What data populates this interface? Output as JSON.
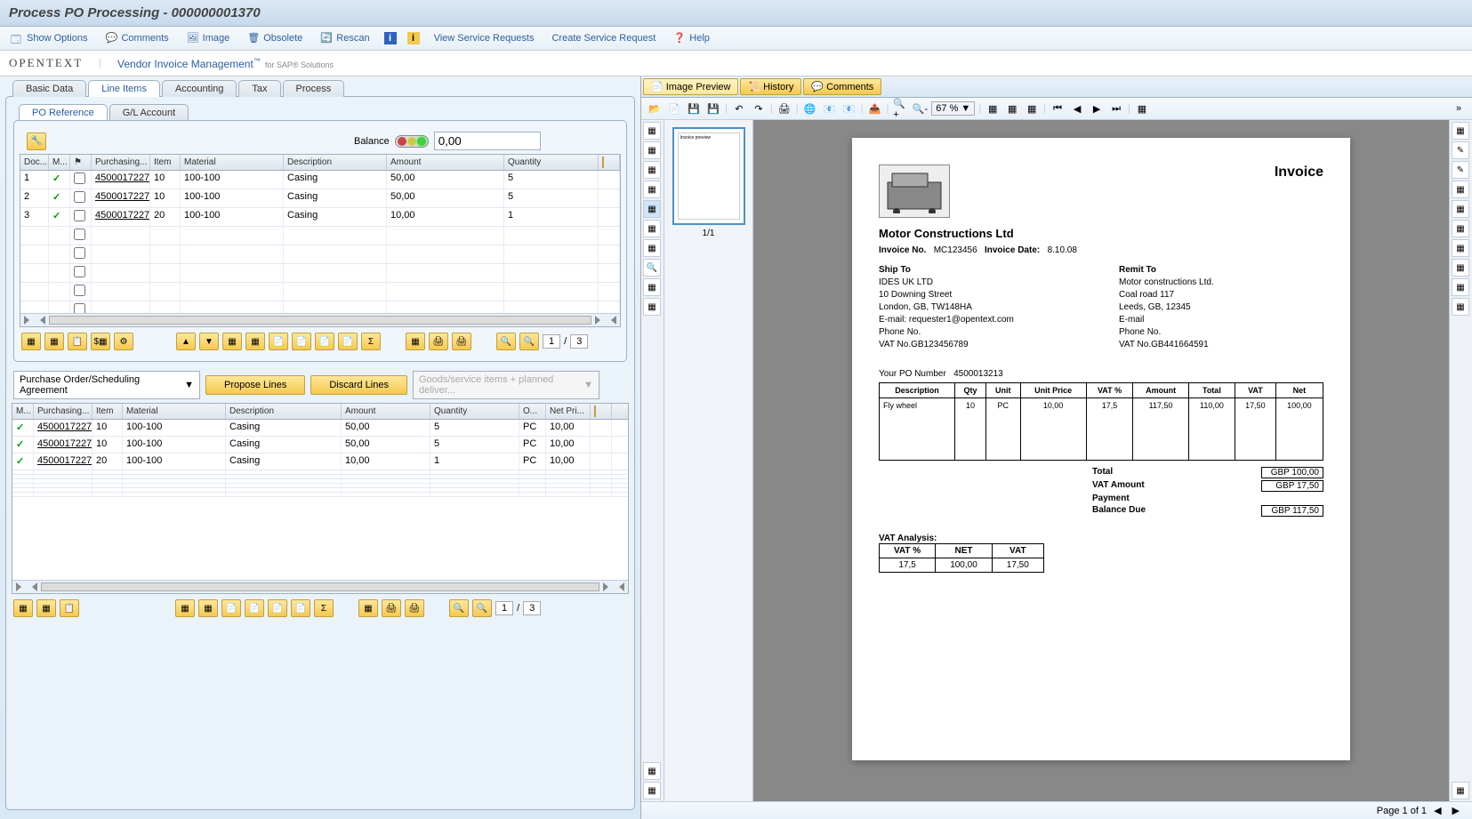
{
  "window": {
    "title": "Process PO Processing - 000000001370"
  },
  "toolbar": {
    "show_options": "Show Options",
    "comments": "Comments",
    "image": "Image",
    "obsolete": "Obsolete",
    "rescan": "Rescan",
    "view_sr": "View Service Requests",
    "create_sr": "Create Service Request",
    "help": "Help"
  },
  "brand": {
    "opentext": "OPENTEXT",
    "product": "Vendor Invoice Management",
    "tm": "™",
    "sub": "for SAP® Solutions"
  },
  "tabs": {
    "basic": "Basic Data",
    "line_items": "Line Items",
    "accounting": "Accounting",
    "tax": "Tax",
    "process": "Process"
  },
  "subtabs": {
    "po_ref": "PO Reference",
    "gl_account": "G/L Account"
  },
  "balance": {
    "label": "Balance",
    "value": "0,00"
  },
  "grid1": {
    "headers": {
      "doc": "Doc...",
      "m": "M...",
      "flag": "",
      "purchasing": "Purchasing...",
      "item": "Item",
      "material": "Material",
      "description": "Description",
      "amount": "Amount",
      "quantity": "Quantity"
    },
    "rows": [
      {
        "doc": "1",
        "chk": true,
        "po": "4500017227",
        "item": "10",
        "material": "100-100",
        "desc": "Casing",
        "amount": "50,00",
        "qty": "5"
      },
      {
        "doc": "2",
        "chk": true,
        "po": "4500017227",
        "item": "10",
        "material": "100-100",
        "desc": "Casing",
        "amount": "50,00",
        "qty": "5"
      },
      {
        "doc": "3",
        "chk": true,
        "po": "4500017227",
        "item": "20",
        "material": "100-100",
        "desc": "Casing",
        "amount": "10,00",
        "qty": "1"
      }
    ],
    "page_current": "1",
    "page_sep": "/",
    "page_total": "3"
  },
  "actions": {
    "po_schedule": "Purchase Order/Scheduling Agreement",
    "propose": "Propose Lines",
    "discard": "Discard Lines",
    "goods": "Goods/service items + planned deliver..."
  },
  "grid2": {
    "headers": {
      "m": "M...",
      "purchasing": "Purchasing...",
      "item": "Item",
      "material": "Material",
      "description": "Description",
      "amount": "Amount",
      "quantity": "Quantity",
      "o": "O...",
      "netpr": "Net Pri..."
    },
    "rows": [
      {
        "chk": true,
        "po": "4500017227",
        "item": "10",
        "material": "100-100",
        "desc": "Casing",
        "amount": "50,00",
        "qty": "5",
        "o": "PC",
        "netpr": "10,00"
      },
      {
        "chk": true,
        "po": "4500017227",
        "item": "10",
        "material": "100-100",
        "desc": "Casing",
        "amount": "50,00",
        "qty": "5",
        "o": "PC",
        "netpr": "10,00"
      },
      {
        "chk": true,
        "po": "4500017227",
        "item": "20",
        "material": "100-100",
        "desc": "Casing",
        "amount": "10,00",
        "qty": "1",
        "o": "PC",
        "netpr": "10,00"
      }
    ],
    "page_current": "1",
    "page_sep": "/",
    "page_total": "3"
  },
  "right_tabs": {
    "preview": "Image Preview",
    "history": "History",
    "comments": "Comments"
  },
  "zoom": "67 %",
  "thumb_label": "1/1",
  "invoice": {
    "title": "Invoice",
    "company": "Motor Constructions Ltd",
    "inv_no_label": "Invoice No.",
    "inv_no": "MC123456",
    "inv_date_label": "Invoice Date:",
    "inv_date": "8.10.08",
    "ship_label": "Ship To",
    "ship": {
      "name": "IDES UK LTD",
      "addr1": "10 Downing Street",
      "addr2": "London, GB, TW148HA",
      "email": "E-mail: requester1@opentext.com",
      "phone": "Phone No.",
      "vat": "VAT No.GB123456789"
    },
    "remit_label": "Remit To",
    "remit": {
      "name": "Motor constructions Ltd.",
      "addr1": "Coal road  117",
      "addr2": "Leeds, GB, 12345",
      "email": "E-mail",
      "phone": "Phone No.",
      "vat": "VAT No.GB441664591"
    },
    "po_label": "Your PO Number",
    "po_no": "4500013213",
    "table": {
      "headers": {
        "desc": "Description",
        "qty": "Qty",
        "unit": "Unit",
        "uprice": "Unit Price",
        "vatp": "VAT %",
        "amount": "Amount",
        "total": "Total",
        "vat": "VAT",
        "net": "Net"
      },
      "rows": [
        {
          "desc": "Fly wheel",
          "qty": "10",
          "unit": "PC",
          "uprice": "10,00",
          "vatp": "17,5",
          "amount": "117,50",
          "total": "110,00",
          "vat": "17,50",
          "net": "100,00"
        }
      ]
    },
    "totals": {
      "total_l": "Total",
      "total_v": "GBP  100,00",
      "vat_l": "VAT Amount",
      "vat_v": "GBP    17,50",
      "pay_l": "Payment",
      "bal_l": "Balance Due",
      "bal_v": "GBP  117,50"
    },
    "vat_analysis": {
      "title": "VAT Analysis:",
      "headers": {
        "vatp": "VAT %",
        "net": "NET",
        "vat": "VAT"
      },
      "row": {
        "vatp": "17,5",
        "net": "100,00",
        "vat": "17,50"
      }
    }
  },
  "status": {
    "page_label": "Page 1 of 1"
  }
}
